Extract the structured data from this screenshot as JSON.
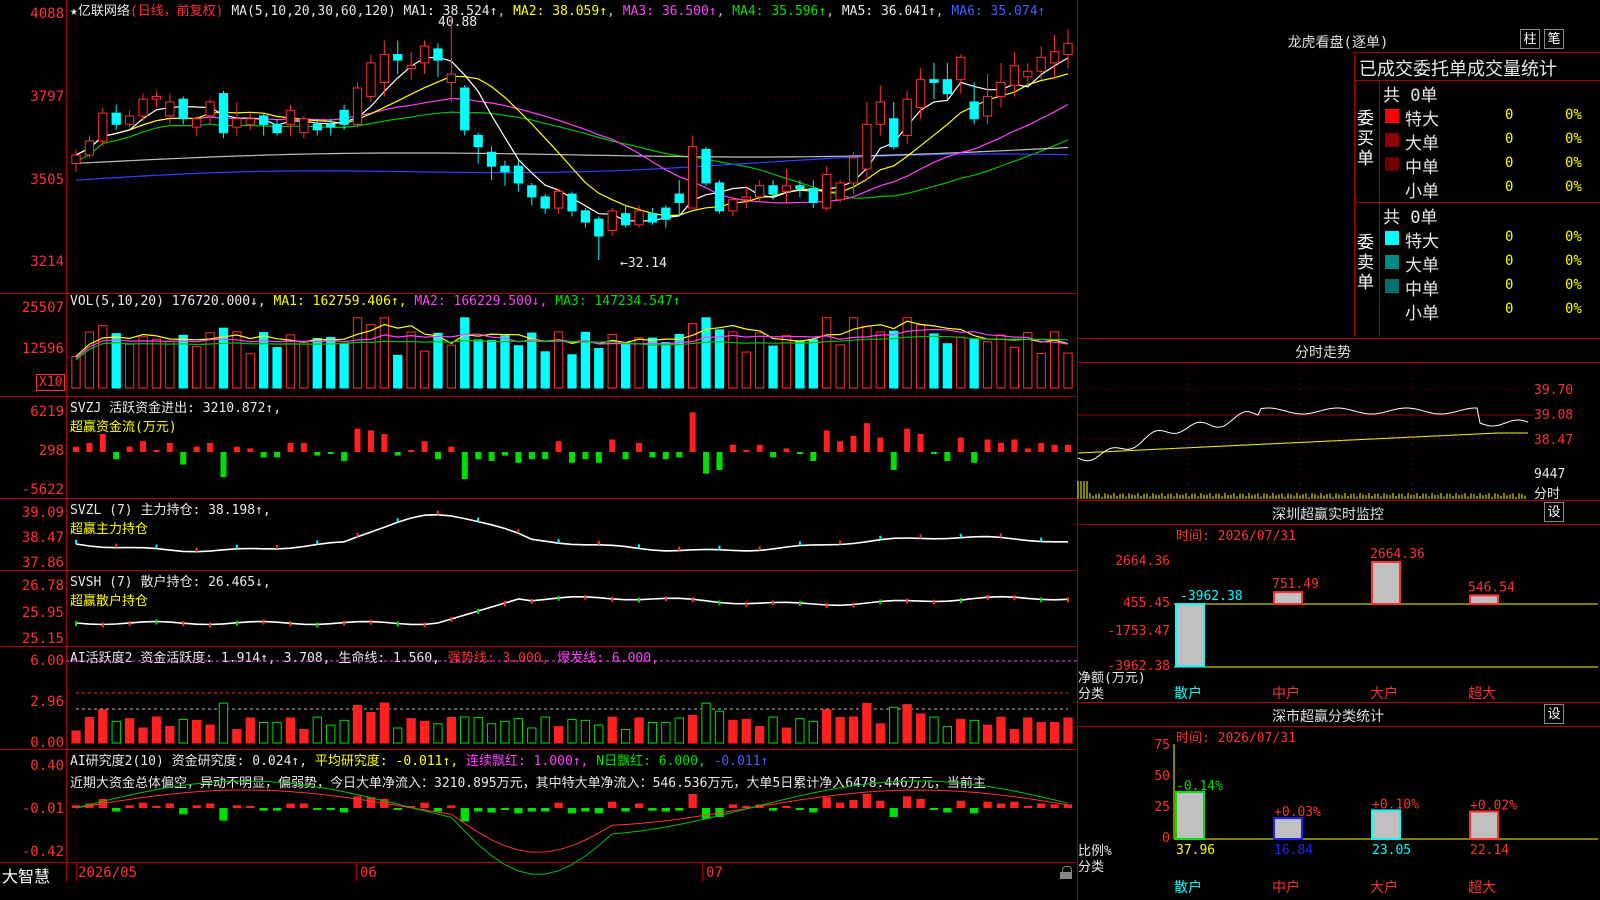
{
  "main_panel": {
    "title_star": "★",
    "stock_name": "亿联网络",
    "period_label": "(日线，前复权)",
    "ma_label": "MA(5,10,20,30,60,120)",
    "ma1": "MA1: 38.524↑",
    "ma2": "MA2: 38.059↑",
    "ma3": "MA3: 36.500↑",
    "ma4": "MA4: 35.596↑",
    "ma5": "MA5: 36.041↑",
    "ma6": "MA6: 35.074↑",
    "high_mark": "40.88",
    "low_mark": "←32.14",
    "y_ticks": [
      "4088",
      "3797",
      "3505",
      "3214"
    ]
  },
  "vol_panel": {
    "label": "VOL(5,10,20)",
    "vol": "176720.000↓,",
    "ma1": "MA1: 162759.406↑,",
    "ma2": "MA2: 166229.500↓,",
    "ma3": "MA3: 147234.547↑",
    "y_ticks": [
      "25507",
      "12596"
    ],
    "unit": "X10"
  },
  "svzj_panel": {
    "label": "SVZJ  活跃资金进出: 3210.872↑,",
    "sub": "超赢资金流(万元)",
    "y_ticks": [
      "6219",
      "298",
      "-5622"
    ]
  },
  "svzl_panel": {
    "label": "SVZL (7) 主力持仓: 38.198↑,",
    "sub": "超赢主力持仓",
    "y_ticks": [
      "39.09",
      "38.47",
      "37.86"
    ]
  },
  "svsh_panel": {
    "label": "SVSH (7) 散户持仓: 26.465↓,",
    "sub": "超赢散户持仓",
    "y_ticks": [
      "26.78",
      "25.95",
      "25.15"
    ]
  },
  "ai_panel": {
    "label": "AI活跃度2 资金活跃度: 1.914↑, 3.708,",
    "life": "生命线: 1.560,",
    "strong": "强势线: 3.000,",
    "burst": "爆发线: 6.000,",
    "y_ticks": [
      "6.00",
      "2.96",
      "0.00"
    ]
  },
  "research_panel": {
    "label": "AI研究度2(10) 资金研究度: 0.024↑,",
    "avg": "平均研究度: -0.011↑,",
    "cont": "连续飘红: 1.000↑,",
    "nday": "N日飘红: 6.000,",
    "extra": "-0.011↑",
    "comment": "近期大资金总体偏空，异动不明显，偏弱势，今日大单净流入：3210.895万元，其中特大单净流入：546.536万元，大单5日累计净入6478.446万元，当前主",
    "y_ticks": [
      "0.40",
      "-0.01",
      "-0.42"
    ]
  },
  "bottom_bar": {
    "brand": "大智慧",
    "dates": [
      "2026/05",
      "06",
      "07"
    ]
  },
  "right": {
    "lhb_title": "龙虎看盘(逐单)",
    "btn_zhu": "柱",
    "btn_bi": "笔",
    "stats_header": "已成交委托单成交量统计",
    "buy_label": "委买单",
    "sell_label": "委卖单",
    "buy_total": "共 0单",
    "sell_total": "共 0单",
    "buy_rows": [
      {
        "name": "特大",
        "val": "0",
        "pct": "0%",
        "color": "#ff0000"
      },
      {
        "name": "大单",
        "val": "0",
        "pct": "0%",
        "color": "#900000"
      },
      {
        "name": "中单",
        "val": "0",
        "pct": "0%",
        "color": "#700000"
      },
      {
        "name": "小单",
        "val": "0",
        "pct": "0%",
        "color": "#000000"
      }
    ],
    "sell_rows": [
      {
        "name": "特大",
        "val": "0",
        "pct": "0%",
        "color": "#00ffff"
      },
      {
        "name": "大单",
        "val": "0",
        "pct": "0%",
        "color": "#008888"
      },
      {
        "name": "中单",
        "val": "0",
        "pct": "0%",
        "color": "#006f6f"
      },
      {
        "name": "小单",
        "val": "0",
        "pct": "0%",
        "color": "#000000"
      }
    ],
    "intraday_title": "分时走势",
    "intraday_ticks": [
      "39.70",
      "39.08",
      "38.47",
      "9447",
      "分时"
    ],
    "monitor_title": "深圳超赢实时监控",
    "monitor_btn": "设",
    "monitor_time": "时间: 2026/07/31",
    "monitor_ticks": [
      "2664.36",
      "455.45",
      "-1753.47",
      "-3962.38"
    ],
    "monitor_values": [
      "-3962.38",
      "751.49",
      "2664.36",
      "546.54"
    ],
    "monitor_unit": "净额(万元)",
    "monitor_cat": "分类",
    "cat_labels": [
      "散户",
      "中户",
      "大户",
      "超大"
    ],
    "stats_title": "深市超赢分类统计",
    "stats_btn": "设",
    "stats_time": "时间: 2026/07/31",
    "stats_ticks": [
      "75",
      "50",
      "25",
      "0"
    ],
    "stats_pcts": [
      "-0.14%",
      "+0.03%",
      "+0.10%",
      "+0.02%"
    ],
    "stats_values": [
      "37.96",
      "16.84",
      "23.05",
      "22.14"
    ],
    "stats_unit": "比例%",
    "stats_cat": "分类"
  },
  "chart_data": {
    "type": "candlestick",
    "title": "亿联网络 (日线，前复权)",
    "y_range": [
      32.14,
      40.88
    ],
    "ma_values": {
      "MA1": 38.524,
      "MA2": 38.059,
      "MA3": 36.5,
      "MA4": 35.596,
      "MA5": 36.041,
      "MA6": 35.074
    },
    "candles": [
      [
        35.6,
        35.9,
        35.3,
        36.1
      ],
      [
        35.9,
        36.4,
        35.8,
        36.6
      ],
      [
        36.4,
        37.4,
        36.2,
        37.6
      ],
      [
        37.4,
        37.0,
        36.8,
        37.7
      ],
      [
        37.0,
        37.3,
        36.9,
        37.5
      ],
      [
        37.3,
        37.9,
        37.1,
        38.1
      ],
      [
        37.9,
        38.0,
        37.6,
        38.2
      ],
      [
        37.3,
        37.8,
        37.0,
        38.1
      ],
      [
        37.9,
        37.2,
        37.0,
        38.0
      ],
      [
        36.9,
        37.2,
        36.6,
        37.3
      ],
      [
        37.3,
        37.8,
        37.0,
        37.9
      ],
      [
        38.1,
        36.7,
        36.5,
        38.2
      ],
      [
        36.9,
        37.2,
        36.6,
        37.8
      ],
      [
        37.0,
        37.2,
        36.8,
        37.4
      ],
      [
        37.3,
        37.0,
        36.6,
        37.4
      ],
      [
        37.0,
        36.7,
        36.6,
        37.2
      ],
      [
        37.0,
        37.5,
        36.6,
        37.7
      ],
      [
        36.7,
        37.2,
        36.5,
        37.3
      ],
      [
        37.0,
        36.8,
        36.6,
        37.2
      ],
      [
        37.0,
        36.9,
        36.6,
        37.2
      ],
      [
        37.5,
        37.0,
        36.8,
        37.7
      ],
      [
        37.0,
        38.3,
        36.9,
        38.5
      ],
      [
        38.0,
        39.2,
        37.8,
        39.5
      ],
      [
        38.5,
        39.5,
        38.0,
        40.0
      ],
      [
        39.5,
        39.3,
        38.8,
        40.0
      ],
      [
        39.0,
        39.1,
        38.6,
        39.6
      ],
      [
        39.2,
        39.8,
        38.8,
        40.0
      ],
      [
        39.7,
        39.3,
        38.7,
        39.9
      ],
      [
        38.5,
        38.8,
        37.8,
        40.88
      ],
      [
        38.3,
        36.8,
        36.6,
        38.4
      ],
      [
        36.6,
        36.2,
        35.6,
        36.7
      ],
      [
        36.0,
        35.5,
        35.0,
        36.2
      ],
      [
        35.5,
        35.3,
        34.8,
        35.7
      ],
      [
        35.5,
        34.9,
        34.6,
        35.7
      ],
      [
        34.8,
        34.4,
        34.1,
        34.9
      ],
      [
        34.4,
        34.0,
        33.8,
        34.5
      ],
      [
        34.0,
        34.6,
        33.8,
        34.7
      ],
      [
        34.5,
        33.9,
        33.7,
        34.6
      ],
      [
        33.9,
        33.5,
        33.3,
        34.0
      ],
      [
        33.6,
        33.0,
        32.14,
        33.7
      ],
      [
        33.2,
        33.9,
        33.0,
        34.0
      ],
      [
        33.8,
        33.4,
        33.3,
        34.1
      ],
      [
        33.4,
        33.9,
        33.3,
        34.1
      ],
      [
        33.8,
        33.5,
        33.4,
        34.0
      ],
      [
        34.0,
        33.6,
        33.3,
        34.1
      ],
      [
        34.5,
        34.2,
        33.7,
        35.0
      ],
      [
        34.0,
        36.2,
        34.0,
        36.6
      ],
      [
        36.1,
        34.9,
        34.8,
        36.2
      ],
      [
        34.9,
        33.9,
        33.8,
        35.0
      ],
      [
        33.9,
        34.3,
        33.7,
        34.4
      ],
      [
        34.3,
        34.4,
        34.0,
        34.8
      ],
      [
        34.4,
        34.8,
        34.2,
        35.0
      ],
      [
        34.8,
        34.5,
        34.3,
        35.0
      ],
      [
        34.6,
        34.8,
        34.2,
        35.4
      ],
      [
        34.8,
        34.7,
        34.4,
        35.0
      ],
      [
        34.7,
        34.2,
        34.0,
        35.0
      ],
      [
        34.0,
        35.2,
        33.9,
        35.5
      ],
      [
        34.3,
        34.9,
        34.2,
        35.0
      ],
      [
        34.9,
        35.8,
        34.5,
        36.0
      ],
      [
        35.4,
        37.0,
        35.0,
        37.8
      ],
      [
        37.0,
        37.8,
        36.6,
        38.4
      ],
      [
        37.2,
        36.2,
        36.1,
        37.8
      ],
      [
        36.6,
        37.9,
        36.3,
        38.2
      ],
      [
        37.6,
        38.6,
        37.2,
        39.0
      ],
      [
        38.6,
        38.5,
        37.9,
        39.2
      ],
      [
        38.6,
        38.1,
        37.9,
        39.2
      ],
      [
        38.6,
        39.4,
        38.1,
        39.5
      ],
      [
        37.8,
        37.2,
        37.0,
        38.5
      ],
      [
        37.3,
        38.0,
        37.0,
        38.8
      ],
      [
        38.0,
        38.5,
        37.6,
        39.2
      ],
      [
        38.4,
        39.1,
        38.0,
        39.6
      ],
      [
        38.7,
        38.9,
        38.4,
        39.2
      ],
      [
        38.9,
        39.4,
        38.6,
        39.8
      ],
      [
        39.2,
        39.6,
        38.6,
        40.2
      ],
      [
        39.5,
        39.9,
        39.0,
        40.4
      ]
    ]
  }
}
